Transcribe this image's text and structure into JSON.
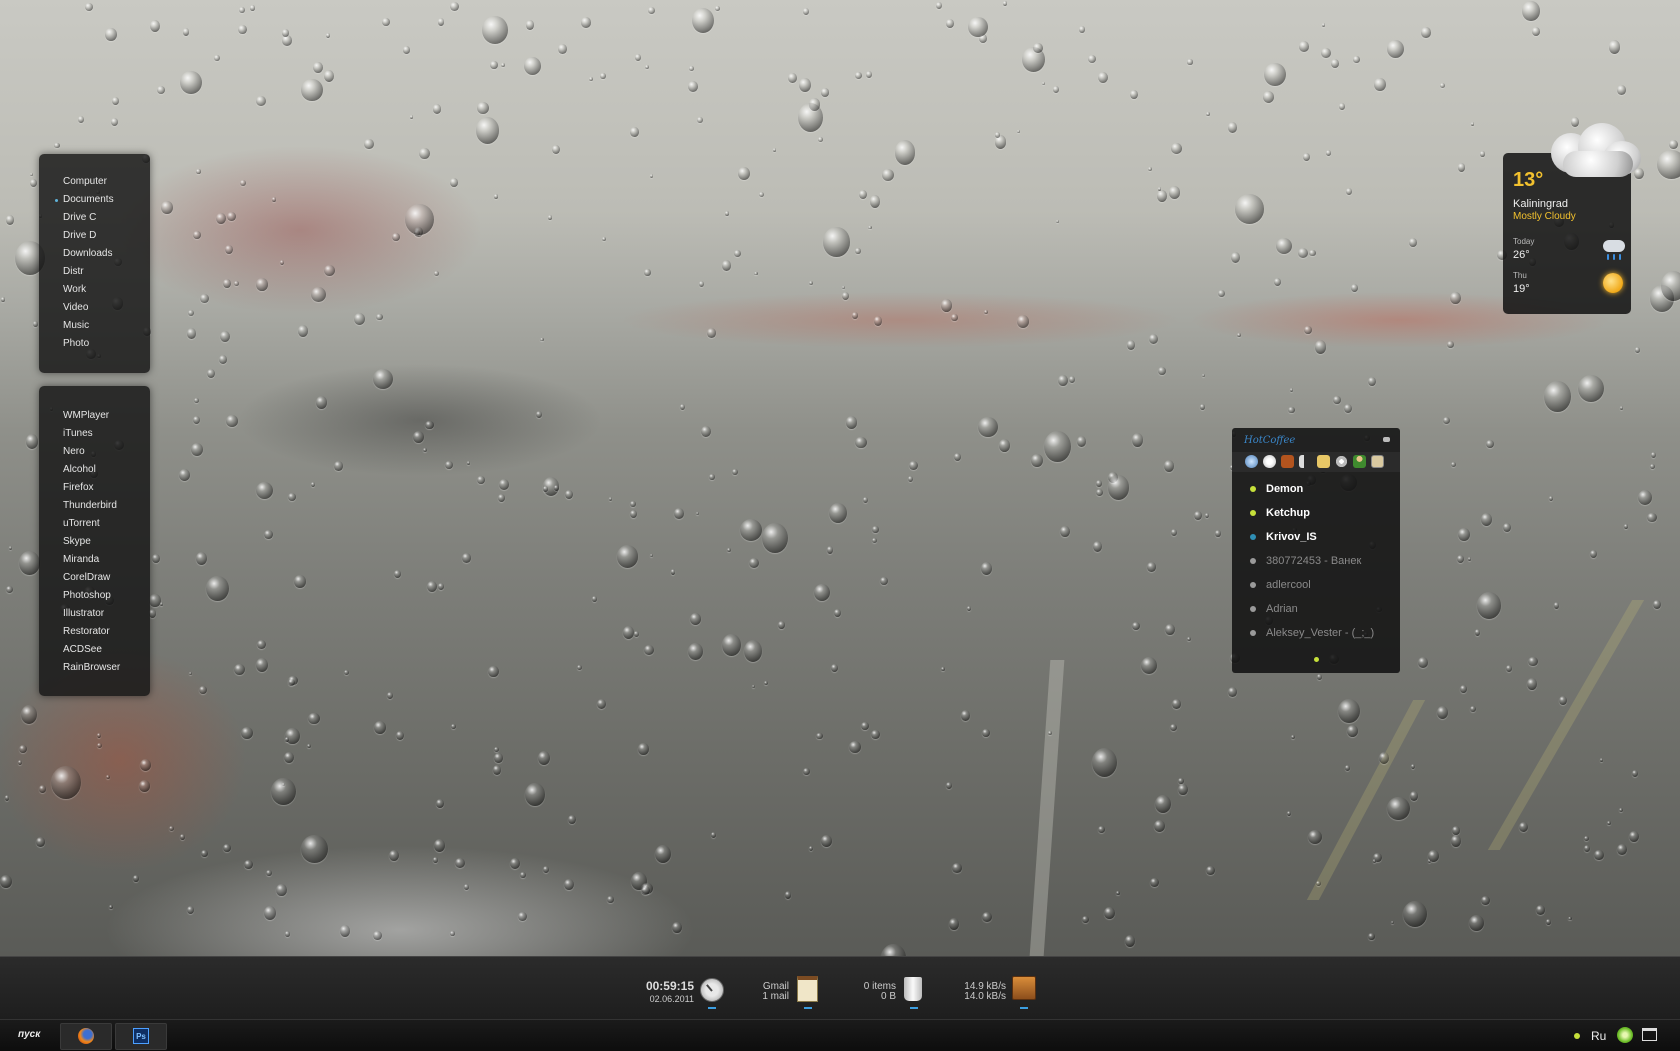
{
  "places_menu": {
    "items": [
      {
        "label": "Computer"
      },
      {
        "label": "Documents",
        "active": true
      },
      {
        "label": "Drive C"
      },
      {
        "label": "Drive D"
      },
      {
        "label": "Downloads"
      },
      {
        "label": "Distr"
      },
      {
        "label": "Work"
      },
      {
        "label": "Video"
      },
      {
        "label": "Music"
      },
      {
        "label": "Photo"
      }
    ]
  },
  "apps_menu": {
    "items": [
      {
        "label": "WMPlayer"
      },
      {
        "label": "iTunes"
      },
      {
        "label": "Nero"
      },
      {
        "label": "Alcohol"
      },
      {
        "label": "Firefox"
      },
      {
        "label": "Thunderbird"
      },
      {
        "label": "uTorrent"
      },
      {
        "label": "Skype"
      },
      {
        "label": "Miranda"
      },
      {
        "label": "CorelDraw"
      },
      {
        "label": "Photoshop"
      },
      {
        "label": "Illustrator"
      },
      {
        "label": "Restorator"
      },
      {
        "label": "ACDSee"
      },
      {
        "label": "RainBrowser"
      }
    ]
  },
  "weather": {
    "temp": "13°",
    "city": "Kaliningrad",
    "condition": "Mostly Cloudy",
    "today_label": "Today",
    "today_temp": "26°",
    "next_label": "Thu",
    "next_temp": "19°",
    "accent_color": "#f2c12e"
  },
  "hotcoffee": {
    "title": "HotCoffee",
    "contacts": [
      {
        "name": "Demon",
        "status": "online",
        "color": "#c6e03a"
      },
      {
        "name": "Ketchup",
        "status": "online",
        "color": "#c6e03a"
      },
      {
        "name": "Krivov_IS",
        "status": "online",
        "color": "#2f8fb5"
      },
      {
        "name": "380772453 - Ванек",
        "status": "offline",
        "color": "#9a9a9a"
      },
      {
        "name": "adlercool",
        "status": "offline",
        "color": "#9a9a9a"
      },
      {
        "name": "Adrian",
        "status": "offline",
        "color": "#9a9a9a"
      },
      {
        "name": "Aleksey_Vester - (_;_)",
        "status": "offline",
        "color": "#9a9a9a"
      }
    ]
  },
  "dock": {
    "time": "00:59:15",
    "date": "02.06.2011",
    "mail_service": "Gmail",
    "mail_count": "1 mail",
    "recycle_items": "0 items",
    "recycle_size": "0 B",
    "net_down": "14.9 kB/s",
    "net_up": "14.0 kB/s",
    "icons": [
      "clock-icon",
      "notepad-icon",
      "recycle-bin-icon",
      "network-box-icon"
    ]
  },
  "taskbar": {
    "start_label": "пуск",
    "tasks": [
      "firefox-icon",
      "photoshop-icon"
    ],
    "photoshop_label": "Ps",
    "language": "Ru"
  }
}
